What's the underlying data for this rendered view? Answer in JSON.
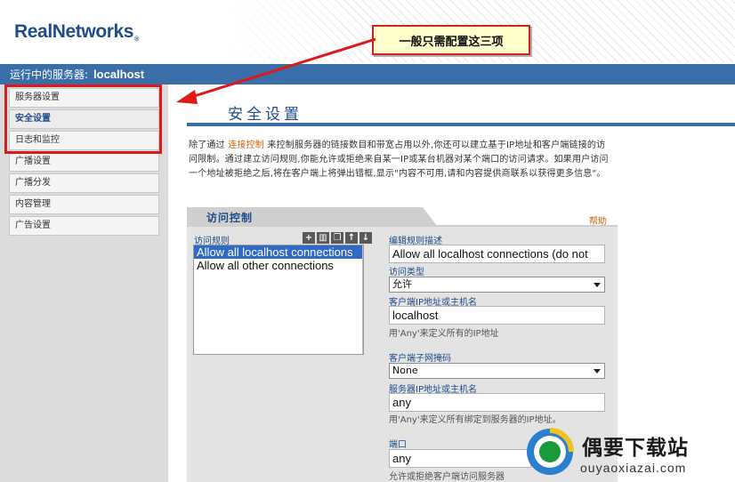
{
  "brand": {
    "logo_text": "RealNetworks",
    "registered": "®"
  },
  "callout": {
    "text": "一般只需配置这三项"
  },
  "server_bar": {
    "label": "运行中的服务器:",
    "host": "localhost"
  },
  "sidebar": {
    "items": [
      {
        "label": "服务器设置"
      },
      {
        "label": "安全设置"
      },
      {
        "label": "日志和监控"
      },
      {
        "label": "广播设置"
      },
      {
        "label": "广播分发"
      },
      {
        "label": "内容管理"
      },
      {
        "label": "广告设置"
      }
    ]
  },
  "main": {
    "title": "安全设置",
    "intro_pre": "除了通过 ",
    "intro_link": "连接控制",
    "intro_post": " 来控制服务器的链接数目和带宽占用以外,你还可以建立基于IP地址和客户端链接的访问限制。通过建立访问规则,你能允许或拒绝来自某一IP或某台机器对某个端口的访问请求。如果用户访问一个地址被拒绝之后,将在客户端上将弹出错框,显示\"内容不可用,请和内容提供商联系以获得更多信息\"。",
    "panel_title": "访问控制",
    "help": "帮助",
    "rules_label": "访问规则",
    "toolbar": {
      "add": "+",
      "delete": "▥",
      "copy": "❐",
      "up": "↑",
      "down": "↓"
    },
    "rules": [
      "Allow all localhost connections",
      "Allow all other connections"
    ],
    "form": {
      "desc_label": "编辑规则描述",
      "desc_value": "Allow all localhost connections (do not",
      "type_label": "访问类型",
      "type_value": "允许",
      "client_label": "客户端IP地址或主机名",
      "client_value": "localhost",
      "client_hint": "用'Any'来定义所有的IP地址",
      "mask_label": "客户端子网掩码",
      "mask_value": "None",
      "server_label": "服务器IP地址或主机名",
      "server_value": "any",
      "server_hint": "用'Any'来定义所有绑定到服务器的IP地址。",
      "port_label": "端口",
      "port_value": "any",
      "port_hint": "允许或拒绝客户端访问服务器"
    }
  },
  "watermark": {
    "text": "偶要下载站",
    "url": "ouyaoxiazai.com"
  },
  "colors": {
    "brand_blue": "#1f4c8a",
    "bar_blue": "#3a6ea8",
    "accent_red": "#e01818",
    "link_orange": "#c8620a"
  }
}
